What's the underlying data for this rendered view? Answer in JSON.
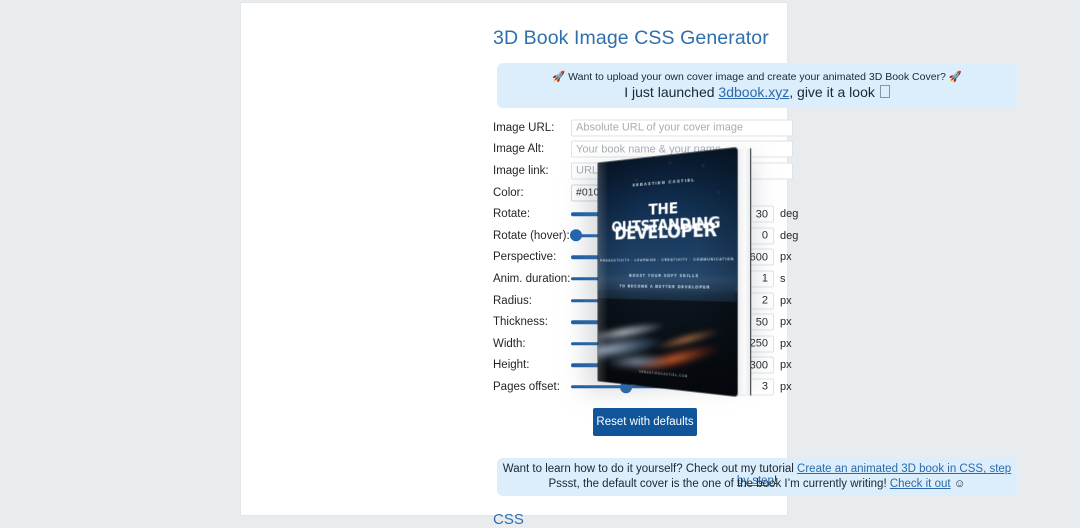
{
  "page": {
    "title": "3D Book Image CSS Generator",
    "background_color": "#e9ecef",
    "accent_color": "#2f6fad",
    "css_section_heading": "CSS"
  },
  "notice_top": {
    "line1": "🚀 Want to upload your own cover image and create your animated 3D Book Cover? 🚀",
    "line2_before": "I just launched ",
    "line2_link": "3dbook.xyz",
    "line2_after": ", give it a look "
  },
  "notice_bottom": {
    "line1_before": "Want to learn how to do it yourself? Check out my tutorial ",
    "line1_link": "Create an animated 3D book in CSS, step by step",
    "line1_after": "!",
    "line2_before": "Pssst, the default cover is the one of the book I’m currently writing! ",
    "line2_link": "Check it out",
    "line2_after": " ☺"
  },
  "form": {
    "text_fields": [
      {
        "label": "Image URL:",
        "placeholder": "Absolute URL of your cover image",
        "value": ""
      },
      {
        "label": "Image Alt:",
        "placeholder": "Your book name & your name",
        "value": ""
      },
      {
        "label": "Image link:",
        "placeholder": "URL of your book's webpage",
        "value": ""
      }
    ],
    "color": {
      "label": "Color:",
      "value": "#01060f",
      "swatch_color": "#01060f"
    },
    "sliders": [
      {
        "label": "Rotate:",
        "value": "30",
        "unit": "deg",
        "fill": 67
      },
      {
        "label": "Rotate (hover):",
        "value": "0",
        "unit": "deg",
        "fill": 3
      },
      {
        "label": "Perspective:",
        "value": "600",
        "unit": "px",
        "fill": 36
      },
      {
        "label": "Anim. duration:",
        "value": "1",
        "unit": "s",
        "fill": 23
      },
      {
        "label": "Radius:",
        "value": "2",
        "unit": "px",
        "fill": 44
      },
      {
        "label": "Thickness:",
        "value": "50",
        "unit": "px",
        "fill": 50
      },
      {
        "label": "Width:",
        "value": "250",
        "unit": "px",
        "fill": 79
      },
      {
        "label": "Height:",
        "value": "300",
        "unit": "px",
        "fill": 62
      },
      {
        "label": "Pages offset:",
        "value": "3",
        "unit": "px",
        "fill": 34
      }
    ],
    "reset_button": "Reset with defaults"
  },
  "book_cover": {
    "author": "SEBASTIEN CASTIEL",
    "title_line1": "THE OUTSTANDING",
    "title_line2": "DEVELOPER",
    "tags": "PRODUCTIVITY · LEARNING · CREATIVITY · COMMUNICATION",
    "subtitle_line1": "BOOST YOUR SOFT SKILLS",
    "subtitle_line2": "TO BECOME A BETTER DEVELOPER",
    "bottom_text": "SEBASTIENCASTIEL.COM"
  }
}
